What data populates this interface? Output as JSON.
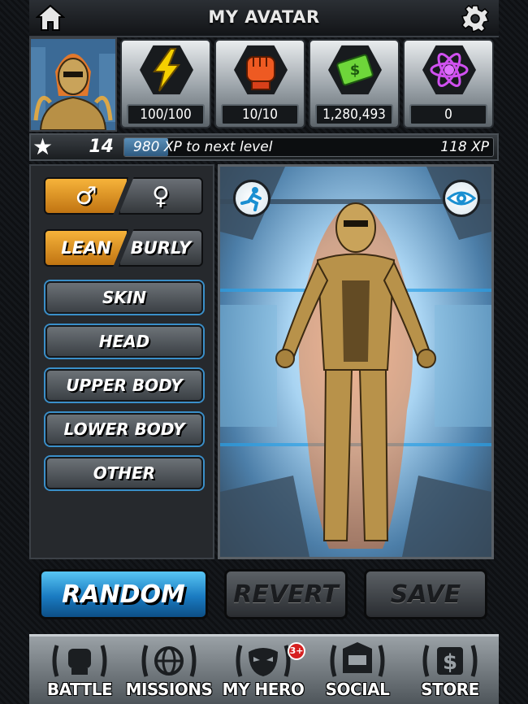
{
  "header": {
    "title": "MY AVATAR",
    "home_icon": "home-icon",
    "settings_icon": "gear-icon"
  },
  "stats": [
    {
      "name": "energy",
      "icon": "lightning-icon",
      "value": "100/100",
      "color": "#f5d000"
    },
    {
      "name": "stamina",
      "icon": "fist-icon",
      "value": "10/10",
      "color": "#e8431a"
    },
    {
      "name": "cash",
      "icon": "cash-icon",
      "value": "1,280,493",
      "color": "#6ed63a"
    },
    {
      "name": "gems",
      "icon": "atom-icon",
      "value": "0",
      "color": "#c040e8"
    }
  ],
  "level_bar": {
    "level": "14",
    "next_level_text": "980 XP to next level",
    "current_xp": "118 XP",
    "progress_fraction": 0.12
  },
  "customize": {
    "gender_options": [
      "male",
      "female"
    ],
    "gender_selected": "male",
    "build_options": [
      "LEAN",
      "BURLY"
    ],
    "build_selected": "LEAN",
    "categories": [
      "SKIN",
      "HEAD",
      "UPPER BODY",
      "LOWER BODY",
      "OTHER"
    ]
  },
  "stage": {
    "left_icon": "running-figure-icon",
    "right_icon": "eye-icon"
  },
  "actions": {
    "random": "RANDOM",
    "revert": "REVERT",
    "save": "SAVE"
  },
  "nav": [
    {
      "label": "BATTLE",
      "icon": "fist-icon"
    },
    {
      "label": "MISSIONS",
      "icon": "globe-icon"
    },
    {
      "label": "MY HERO",
      "icon": "mask-icon",
      "badge": "3+"
    },
    {
      "label": "SOCIAL",
      "icon": "envelope-icon"
    },
    {
      "label": "STORE",
      "icon": "dollar-icon"
    }
  ],
  "colors": {
    "accent_orange": "#e89a22",
    "accent_blue": "#2a9ad9",
    "panel_dark": "#26292d"
  }
}
